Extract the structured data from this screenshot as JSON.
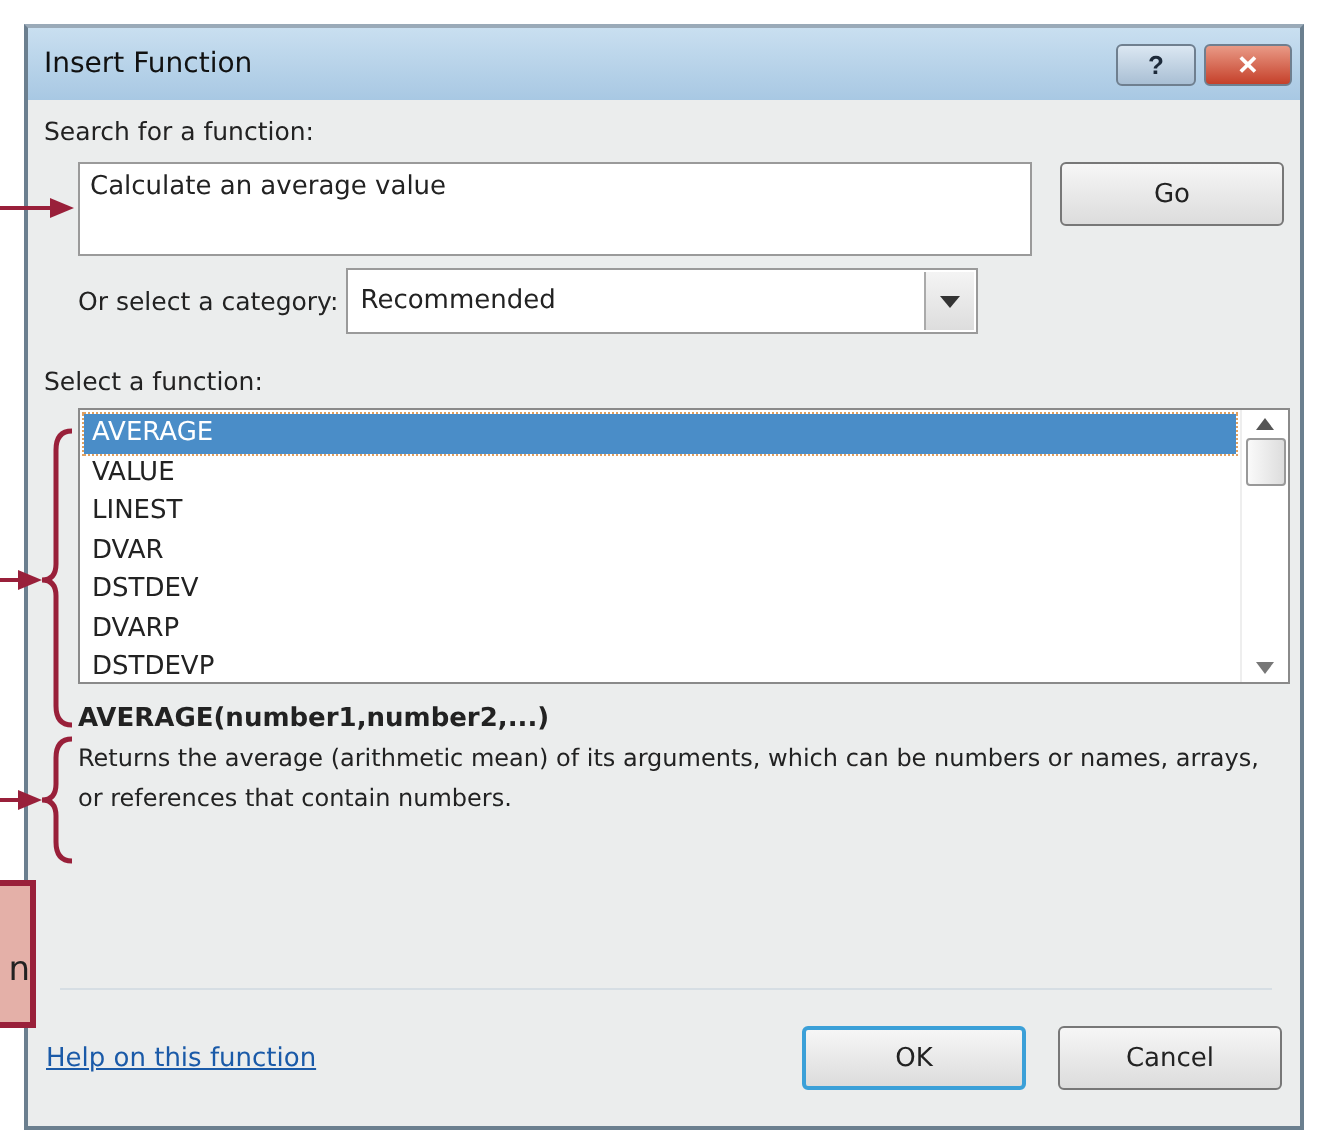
{
  "window": {
    "title": "Insert Function",
    "title_buttons": [
      {
        "kind": "help",
        "label": "?"
      },
      {
        "kind": "close",
        "label": "✕"
      }
    ]
  },
  "search": {
    "label": "Search for a function:",
    "value": "Calculate an average value",
    "button": "Go"
  },
  "category": {
    "label": "Or select a category:",
    "value": "Recommended"
  },
  "function_list": {
    "label": "Select a function:",
    "items": [
      {
        "name": "AVERAGE",
        "selected": true
      },
      {
        "name": "VALUE",
        "selected": false
      },
      {
        "name": "LINEST",
        "selected": false
      },
      {
        "name": "DVAR",
        "selected": false
      },
      {
        "name": "DSTDEV",
        "selected": false
      },
      {
        "name": "DVARP",
        "selected": false
      },
      {
        "name": "DSTDEVP",
        "selected": false
      }
    ]
  },
  "description": {
    "signature": "AVERAGE(number1,number2,...)",
    "text": "Returns the average (arithmetic mean) of its arguments, which can be numbers or names, arrays, or references that contain numbers."
  },
  "footer": {
    "link": "Help on this function",
    "buttons": [
      {
        "label": "OK",
        "default": true
      },
      {
        "label": "Cancel",
        "default": false
      }
    ]
  },
  "callouts": [
    {
      "kind": "arrow"
    },
    {
      "kind": "brace"
    },
    {
      "kind": "brace"
    },
    {
      "kind": "box",
      "text": "n"
    }
  ]
}
